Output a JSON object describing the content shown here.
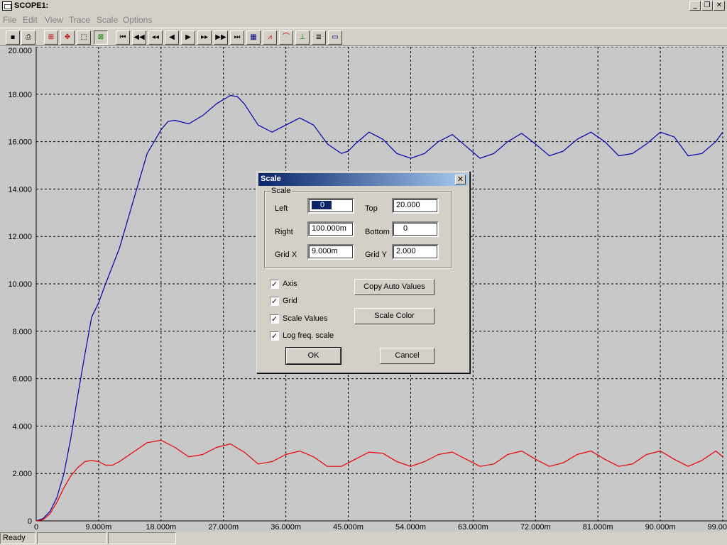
{
  "window": {
    "title": "SCOPE1:"
  },
  "menu": [
    "File",
    "Edit",
    "View",
    "Trace",
    "Scale",
    "Options"
  ],
  "plot": {
    "y_tick_labels": [
      "20.000",
      "18.000",
      "16.000",
      "14.000",
      "12.000",
      "10.000",
      "8.000",
      "6.000",
      "4.000",
      "2.000",
      "0"
    ],
    "x_tick_labels": [
      "0",
      "9.000m",
      "18.000m",
      "27.000m",
      "36.000m",
      "45.000m",
      "54.000m",
      "63.000m",
      "72.000m",
      "81.000m",
      "90.000m",
      "99.00"
    ]
  },
  "chart_data": {
    "type": "line",
    "xlim": [
      0,
      99
    ],
    "ylim": [
      0,
      20
    ],
    "grid": true,
    "x_unit_scale": "m",
    "series": [
      {
        "color": "#0000a8",
        "x": [
          0,
          1,
          2,
          3,
          4,
          5,
          6,
          7,
          8,
          9,
          10,
          12,
          14,
          16,
          18,
          19,
          20,
          22,
          24,
          26,
          28,
          29,
          30,
          32,
          34,
          36,
          38,
          40,
          42,
          44,
          45,
          46,
          48,
          50,
          52,
          54,
          56,
          58,
          60,
          62,
          64,
          66,
          68,
          70,
          72,
          74,
          76,
          78,
          80,
          82,
          84,
          86,
          88,
          90,
          92,
          94,
          96,
          98,
          99
        ],
        "y": [
          0,
          0.1,
          0.4,
          1.0,
          2.0,
          3.5,
          5.3,
          7.0,
          8.6,
          9.2,
          10.0,
          11.5,
          13.5,
          15.5,
          16.5,
          16.85,
          16.9,
          16.75,
          17.1,
          17.6,
          17.95,
          17.9,
          17.6,
          16.7,
          16.4,
          16.7,
          17.0,
          16.7,
          15.9,
          15.5,
          15.6,
          15.9,
          16.4,
          16.1,
          15.5,
          15.3,
          15.5,
          16.0,
          16.3,
          15.8,
          15.3,
          15.5,
          16.0,
          16.35,
          15.9,
          15.4,
          15.6,
          16.1,
          16.4,
          16.0,
          15.4,
          15.5,
          15.9,
          16.4,
          16.2,
          15.4,
          15.5,
          16.0,
          16.4
        ]
      },
      {
        "color": "#e80000",
        "x": [
          0,
          1,
          2,
          3,
          4,
          5,
          6,
          7,
          8,
          9,
          10,
          11,
          12,
          14,
          16,
          18,
          20,
          22,
          24,
          26,
          28,
          30,
          32,
          34,
          36,
          38,
          40,
          42,
          44,
          46,
          48,
          50,
          52,
          54,
          56,
          58,
          60,
          62,
          64,
          66,
          68,
          70,
          72,
          74,
          76,
          78,
          80,
          82,
          84,
          86,
          88,
          90,
          92,
          94,
          96,
          98,
          99
        ],
        "y": [
          0,
          0.05,
          0.3,
          0.8,
          1.4,
          1.9,
          2.25,
          2.5,
          2.55,
          2.5,
          2.35,
          2.35,
          2.5,
          2.9,
          3.3,
          3.4,
          3.1,
          2.7,
          2.8,
          3.1,
          3.25,
          2.9,
          2.4,
          2.5,
          2.8,
          2.95,
          2.7,
          2.3,
          2.3,
          2.6,
          2.9,
          2.85,
          2.5,
          2.3,
          2.5,
          2.8,
          2.9,
          2.6,
          2.3,
          2.4,
          2.8,
          2.95,
          2.6,
          2.3,
          2.45,
          2.8,
          2.95,
          2.6,
          2.3,
          2.4,
          2.8,
          2.95,
          2.6,
          2.3,
          2.55,
          2.95,
          2.7
        ]
      }
    ]
  },
  "dialog": {
    "title": "Scale",
    "close": "✕",
    "group_label": "Scale",
    "left_label": "Left",
    "left_value": "0",
    "top_label": "Top",
    "top_value": "20.000",
    "right_label": "Right",
    "right_value": "100.000m",
    "bottom_label": "Bottom",
    "bottom_value": "0",
    "gridx_label": "Grid X",
    "gridx_value": "9.000m",
    "gridy_label": "Grid Y",
    "gridy_value": "2.000",
    "checkboxes": [
      {
        "label": "Axis",
        "checked": true
      },
      {
        "label": "Grid",
        "checked": true
      },
      {
        "label": "Scale Values",
        "checked": true
      },
      {
        "label": "Log freq. scale",
        "checked": true
      }
    ],
    "copy_auto_label": "Copy Auto Values",
    "scale_color_label": "Scale Color",
    "ok_label": "OK",
    "cancel_label": "Cancel"
  },
  "status": {
    "text": "Ready"
  }
}
